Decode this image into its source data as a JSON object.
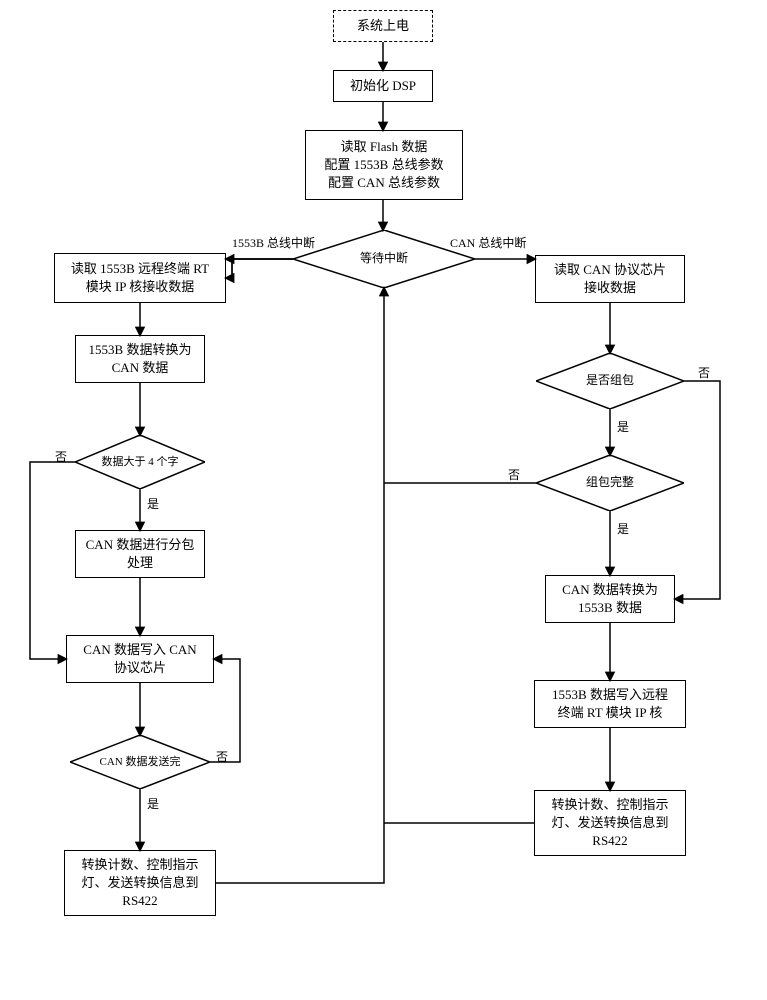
{
  "chart_data": {
    "type": "flowchart",
    "nodes": [
      {
        "id": "powerOn",
        "shape": "dashed-box",
        "text": "系统上电"
      },
      {
        "id": "initDsp",
        "shape": "box",
        "text": "初始化 DSP"
      },
      {
        "id": "readFlash",
        "shape": "box",
        "text": "读取 Flash 数据\n配置 1553B 总线参数\n配置 CAN 总线参数"
      },
      {
        "id": "waitInt",
        "shape": "diamond",
        "text": "等待中断"
      },
      {
        "id": "read1553",
        "shape": "box",
        "text": "读取 1553B 远程终端 RT\n模块 IP 核接收数据"
      },
      {
        "id": "to_can",
        "shape": "box",
        "text": "1553B 数据转换为\nCAN 数据"
      },
      {
        "id": "gt4",
        "shape": "diamond",
        "text": "数据大于 4 个字"
      },
      {
        "id": "split",
        "shape": "box",
        "text": "CAN 数据进行分包\n处理"
      },
      {
        "id": "writeCan",
        "shape": "box",
        "text": "CAN 数据写入 CAN\n协议芯片"
      },
      {
        "id": "sentDone",
        "shape": "diamond",
        "text": "CAN 数据发送完"
      },
      {
        "id": "leftEnd",
        "shape": "box",
        "text": "转换计数、控制指示\n灯、发送转换信息到\nRS422"
      },
      {
        "id": "readCan",
        "shape": "box",
        "text": "读取 CAN 协议芯片\n接收数据"
      },
      {
        "id": "isPacket",
        "shape": "diamond",
        "text": "是否组包"
      },
      {
        "id": "packetComplete",
        "shape": "diamond",
        "text": "组包完整"
      },
      {
        "id": "to1553",
        "shape": "box",
        "text": "CAN 数据转换为\n1553B 数据"
      },
      {
        "id": "write1553",
        "shape": "box",
        "text": "1553B 数据写入远程\n终端 RT 模块 IP 核"
      },
      {
        "id": "rightEnd",
        "shape": "box",
        "text": "转换计数、控制指示\n灯、发送转换信息到\nRS422"
      }
    ],
    "edges": [
      {
        "from": "powerOn",
        "to": "initDsp"
      },
      {
        "from": "initDsp",
        "to": "readFlash"
      },
      {
        "from": "readFlash",
        "to": "waitInt"
      },
      {
        "from": "waitInt",
        "to": "read1553",
        "label": "1553B 总线中断"
      },
      {
        "from": "waitInt",
        "to": "readCan",
        "label": "CAN 总线中断"
      },
      {
        "from": "read1553",
        "to": "to_can"
      },
      {
        "from": "to_can",
        "to": "gt4"
      },
      {
        "from": "gt4",
        "to": "split",
        "label": "是"
      },
      {
        "from": "gt4",
        "to": "writeCan",
        "label": "否"
      },
      {
        "from": "split",
        "to": "writeCan"
      },
      {
        "from": "writeCan",
        "to": "sentDone"
      },
      {
        "from": "sentDone",
        "to": "writeCan",
        "label": "否"
      },
      {
        "from": "sentDone",
        "to": "leftEnd",
        "label": "是"
      },
      {
        "from": "leftEnd",
        "to": "waitInt"
      },
      {
        "from": "readCan",
        "to": "isPacket"
      },
      {
        "from": "isPacket",
        "to": "packetComplete",
        "label": "是"
      },
      {
        "from": "isPacket",
        "to": "to1553",
        "label": "否"
      },
      {
        "from": "packetComplete",
        "to": "to1553",
        "label": "是"
      },
      {
        "from": "packetComplete",
        "to": "waitInt",
        "label": "否"
      },
      {
        "from": "to1553",
        "to": "write1553"
      },
      {
        "from": "write1553",
        "to": "rightEnd"
      },
      {
        "from": "rightEnd",
        "to": "waitInt"
      }
    ]
  },
  "labels": {
    "powerOn": "系统上电",
    "initDsp": "初始化 DSP",
    "readFlash": "读取 Flash 数据<br>配置 1553B 总线参数<br>配置 CAN 总线参数",
    "waitInt": "等待中断",
    "leftBranch": "1553B 总线中断",
    "rightBranch": "CAN 总线中断",
    "read1553": "读取 1553B 远程终端 RT<br>模块 IP 核接收数据",
    "to_can": "1553B 数据转换为<br>CAN 数据",
    "gt4": "数据大于 4 个字",
    "yes": "是",
    "no": "否",
    "split": "CAN 数据进行分包<br>处理",
    "writeCan": "CAN 数据写入 CAN<br>协议芯片",
    "sentDone": "CAN 数据发送完",
    "leftEnd": "转换计数、控制指示<br>灯、发送转换信息到<br>RS422",
    "readCan": "读取 CAN 协议芯片<br>接收数据",
    "isPacket": "是否组包",
    "packetComplete": "组包完整",
    "to1553": "CAN 数据转换为<br>1553B 数据",
    "write1553": "1553B 数据写入远程<br>终端 RT 模块 IP 核",
    "rightEnd": "转换计数、控制指示<br>灯、发送转换信息到<br>RS422"
  }
}
